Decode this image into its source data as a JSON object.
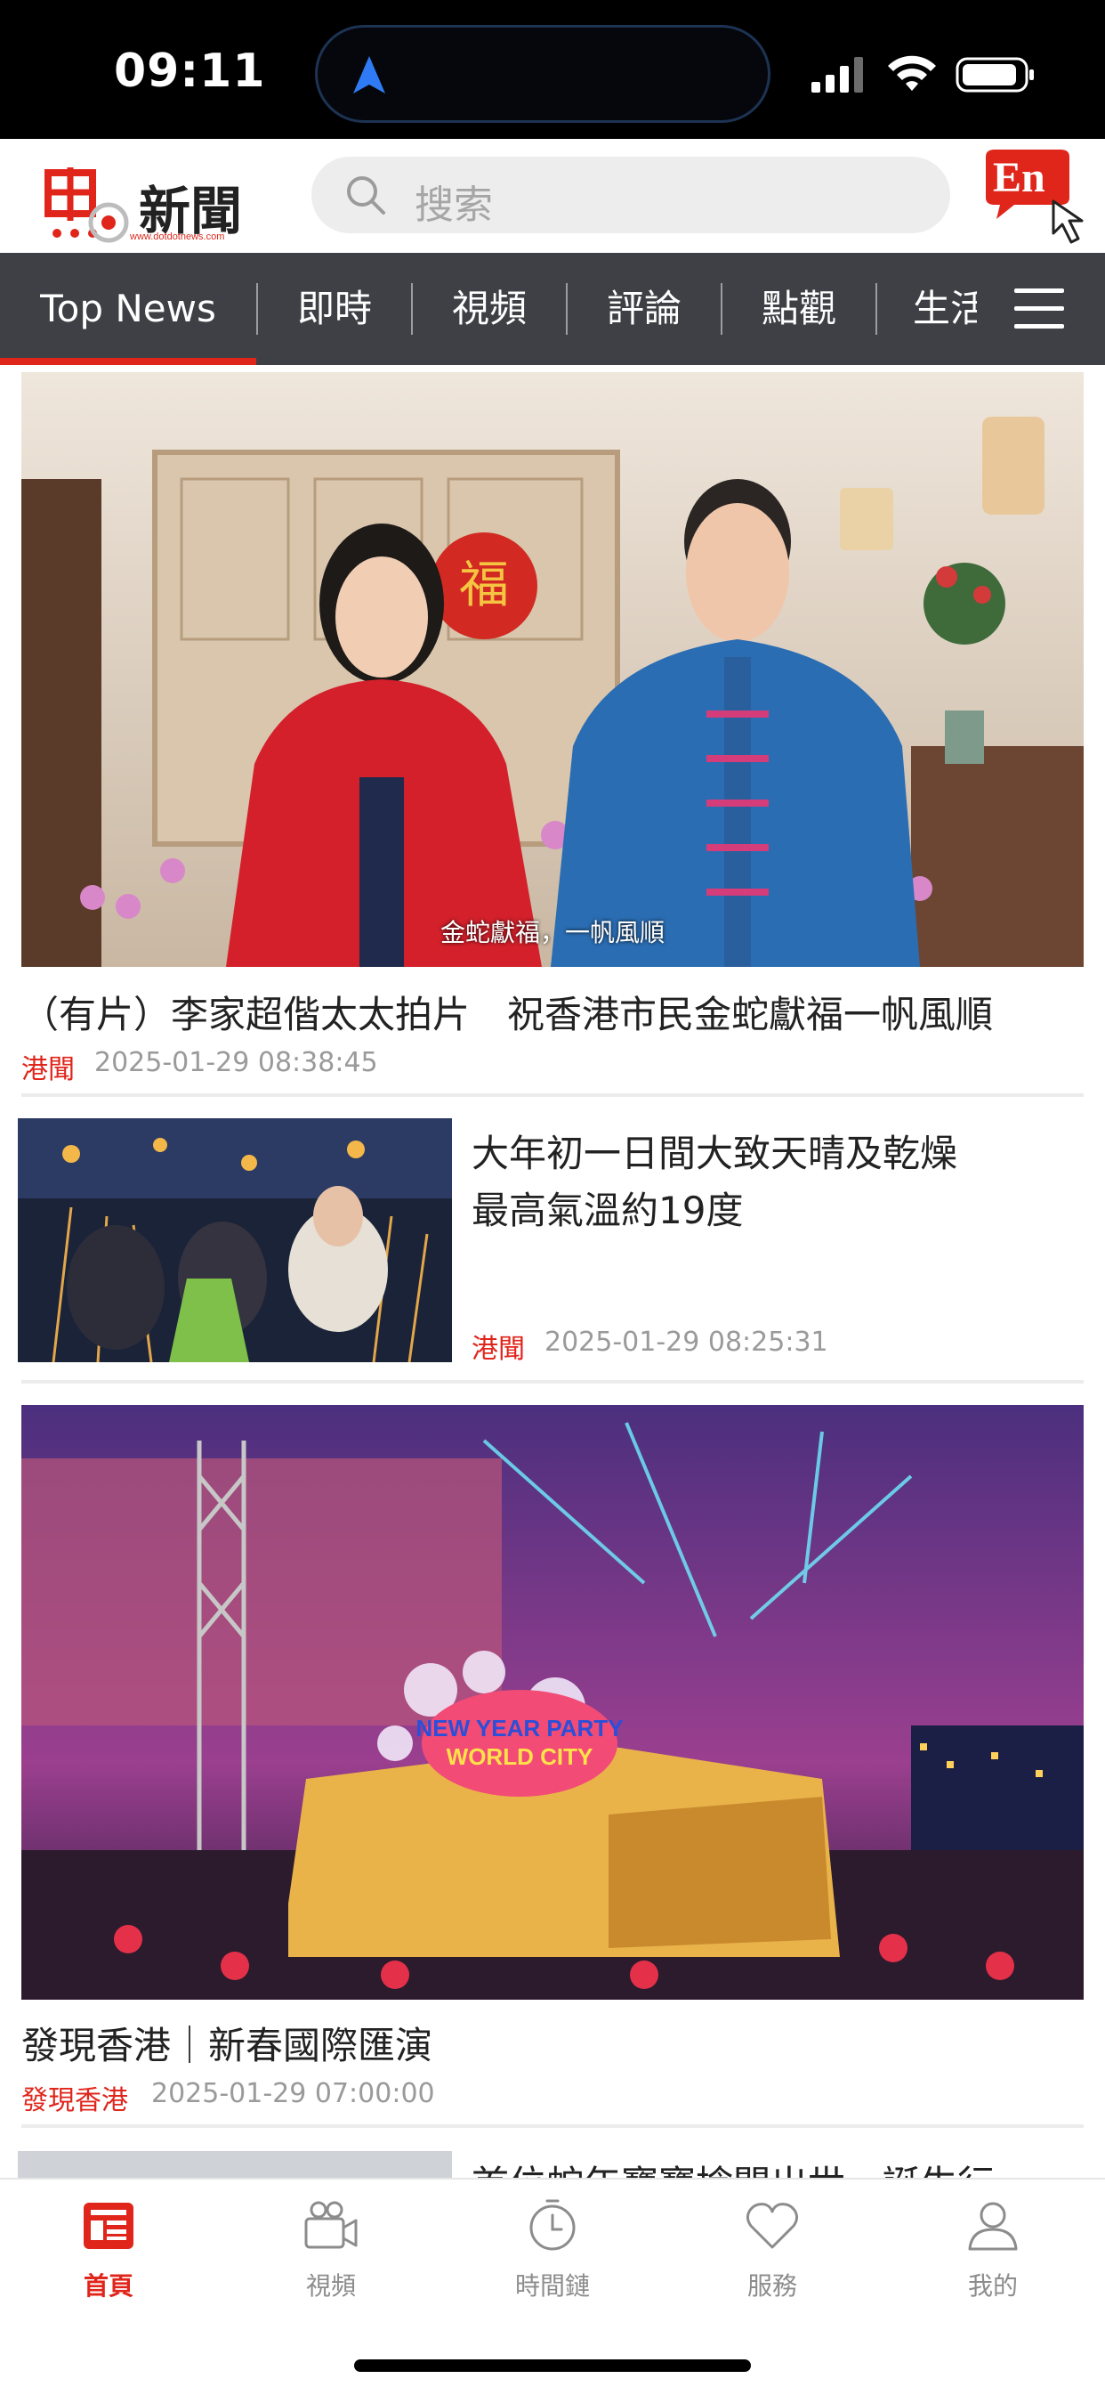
{
  "status_bar": {
    "time": "09:11",
    "icons": [
      "location-arrow-icon",
      "cellular-signal-icon",
      "wifi-icon",
      "battery-icon"
    ]
  },
  "header": {
    "logo_text": "新聞",
    "logo_url": "www.dotdotnews.com",
    "search_placeholder": "搜索",
    "language_button": "En"
  },
  "tabs": [
    {
      "label": "Top News",
      "active": true
    },
    {
      "label": "即時"
    },
    {
      "label": "視頻"
    },
    {
      "label": "評論"
    },
    {
      "label": "點觀"
    },
    {
      "label": "生活"
    }
  ],
  "articles": [
    {
      "title": "（有片）李家超偕太太拍片　祝香港市民金蛇獻福一帆風順",
      "category": "港聞",
      "time": "2025-01-29 08:38:45",
      "image_caption": "金蛇獻福，一帆風順"
    },
    {
      "title_line1": "大年初一日間大致天晴及乾燥",
      "title_line2": "最高氣溫約19度",
      "category": "港聞",
      "time": "2025-01-29 08:25:31"
    },
    {
      "title": "發現香港｜新春國際匯演",
      "category": "發現香港",
      "time": "2025-01-29 07:00:00",
      "image_sign": "NEW YEAR PARTY WORLD CITY"
    },
    {
      "title": "首位蛇年寶寶搶閘出世　誕生行"
    }
  ],
  "bottom_nav": [
    {
      "label": "首頁",
      "icon": "news-home-icon",
      "active": true
    },
    {
      "label": "視頻",
      "icon": "video-camera-icon"
    },
    {
      "label": "時間鏈",
      "icon": "clock-icon"
    },
    {
      "label": "服務",
      "icon": "heart-icon"
    },
    {
      "label": "我的",
      "icon": "user-icon"
    }
  ],
  "colors": {
    "accent": "#e0251b",
    "tab_bar": "#3e4045",
    "status_bar": "#000000"
  }
}
